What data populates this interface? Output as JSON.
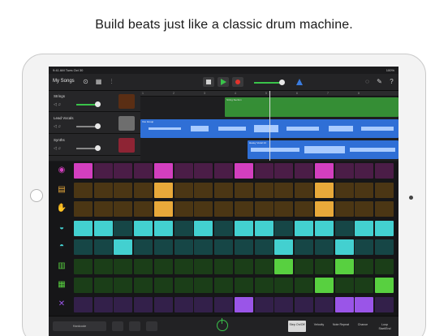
{
  "headline": "Build beats just like a classic drum machine.",
  "statusbar": {
    "time": "9:41 AM  Tues Oct 30",
    "battery": "100%"
  },
  "toolbar": {
    "my_songs": "My Songs"
  },
  "ruler_marks": [
    "1",
    "2",
    "3",
    "4",
    "5",
    "6",
    "7",
    "8"
  ],
  "tracks": [
    {
      "name": "Strings",
      "color": "#3aa23a",
      "instrument_color": "#6b3b1c"
    },
    {
      "name": "Lead Vocals",
      "color": "#2f6fd6",
      "instrument_color": "#777777"
    },
    {
      "name": "Synths",
      "color": "#2f6fd6",
      "instrument_color": "#b03040"
    }
  ],
  "regions": [
    {
      "title": "String Section",
      "color": "#3aa23a"
    },
    {
      "title": "Vox Group",
      "color": "#2f6fd6"
    },
    {
      "title": "Heavy Vocal 14",
      "color": "#2f6fd6"
    }
  ],
  "drum_rows": [
    {
      "icon": "kick-icon",
      "glyph": "◉",
      "on_color": "#d33fbf",
      "off_color": "#4b1d47",
      "steps": [
        1,
        0,
        0,
        0,
        1,
        0,
        0,
        0,
        1,
        0,
        0,
        0,
        1,
        0,
        0,
        0
      ]
    },
    {
      "icon": "snare-icon",
      "glyph": "▤",
      "on_color": "#e8a93a",
      "off_color": "#4b3614",
      "steps": [
        0,
        0,
        0,
        0,
        1,
        0,
        0,
        0,
        0,
        0,
        0,
        0,
        1,
        0,
        0,
        0
      ]
    },
    {
      "icon": "clap-icon",
      "glyph": "✋",
      "on_color": "#e8a93a",
      "off_color": "#4b3614",
      "steps": [
        0,
        0,
        0,
        0,
        1,
        0,
        0,
        0,
        0,
        0,
        0,
        0,
        1,
        0,
        0,
        0
      ]
    },
    {
      "icon": "hihat-closed-icon",
      "glyph": "◒",
      "on_color": "#43d0d0",
      "off_color": "#164646",
      "steps": [
        1,
        1,
        0,
        1,
        1,
        0,
        1,
        0,
        1,
        1,
        0,
        1,
        1,
        0,
        1,
        1
      ]
    },
    {
      "icon": "hihat-open-icon",
      "glyph": "◓",
      "on_color": "#43d0d0",
      "off_color": "#164646",
      "steps": [
        0,
        0,
        1,
        0,
        0,
        0,
        0,
        0,
        0,
        0,
        1,
        0,
        0,
        1,
        0,
        0
      ]
    },
    {
      "icon": "tom-low-icon",
      "glyph": "▥",
      "on_color": "#58d040",
      "off_color": "#1b3e18",
      "steps": [
        0,
        0,
        0,
        0,
        0,
        0,
        0,
        0,
        0,
        0,
        1,
        0,
        0,
        1,
        0,
        0
      ]
    },
    {
      "icon": "tom-high-icon",
      "glyph": "▦",
      "on_color": "#58d040",
      "off_color": "#1b3e18",
      "steps": [
        0,
        0,
        0,
        0,
        0,
        0,
        0,
        0,
        0,
        0,
        0,
        0,
        1,
        0,
        0,
        1
      ]
    },
    {
      "icon": "sticks-icon",
      "glyph": "✕",
      "on_color": "#9a55e8",
      "off_color": "#33204a",
      "steps": [
        0,
        0,
        0,
        0,
        0,
        0,
        0,
        0,
        1,
        0,
        0,
        0,
        0,
        1,
        1,
        0
      ]
    }
  ],
  "bottom": {
    "kit_name": "Hardcode",
    "modes": [
      "Step On/Off",
      "Velocity",
      "Note Repeat",
      "Chance",
      "Loop Start/End"
    ]
  }
}
